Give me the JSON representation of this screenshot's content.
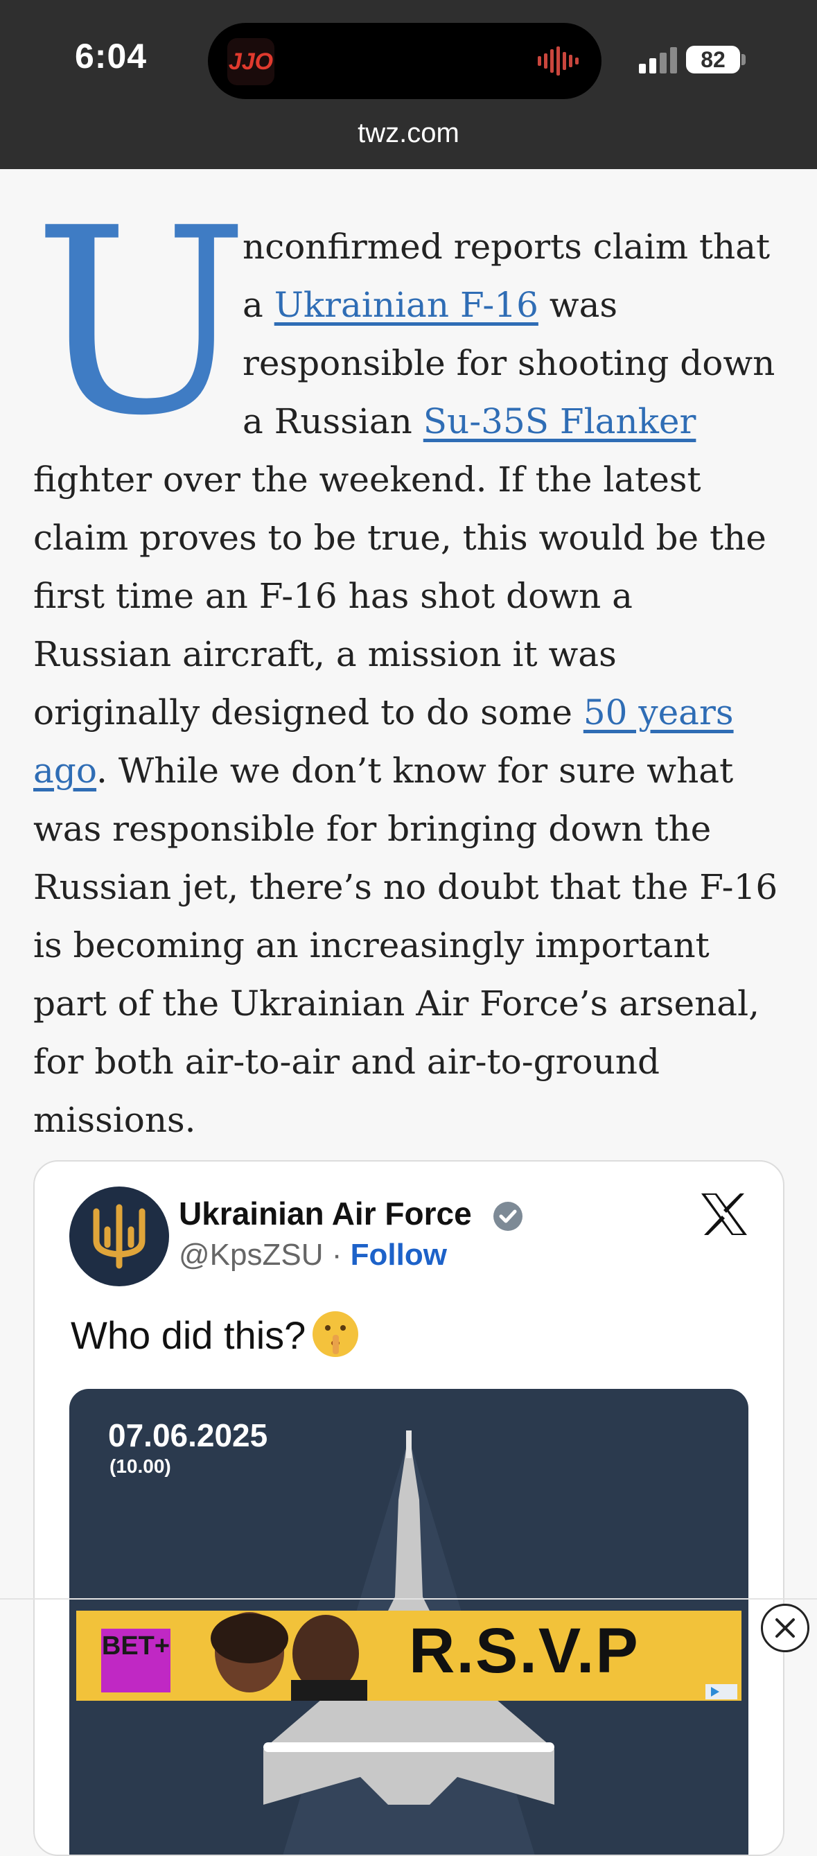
{
  "status_bar": {
    "time": "6:04",
    "island_app_label": "JJO",
    "battery": "82",
    "url": "twz.com"
  },
  "article": {
    "drop_cap": "U",
    "p1_a": "nconfirmed reports claim that a ",
    "link_f16": "Ukrainian F-16",
    "p1_b": " was responsible for shooting down a Russian ",
    "link_su35": "Su-35S Flanker",
    "p1_c": " fighter over the weekend. If the latest claim proves to be true, this would be the first time an F-16 has shot down a Russian aircraft, a mission it was originally designed to do some ",
    "link_50years": "50 years ago",
    "p1_d": ". While we don’t know for sure what was responsible for bringing down the Russian jet, there’s no doubt that the F-16 is becoming an increasingly important part of the Ukrainian Air Force’s arsenal, for both air-to-air and air-to-ground missions."
  },
  "tweet": {
    "name": "Ukrainian Air Force",
    "handle": "@KpsZSU",
    "separator": "·",
    "follow": "Follow",
    "text": "Who did this?",
    "media_date": "07.06.2025",
    "media_time": "(10.00)"
  },
  "ad": {
    "brand": "BET+",
    "headline": "R.S.V.P"
  },
  "colors": {
    "status_bg": "#2f2f2f",
    "link": "#2f6db5",
    "drop_cap": "#3f7cc4",
    "follow": "#1d62c9",
    "ad_bg": "#f2c23a"
  }
}
